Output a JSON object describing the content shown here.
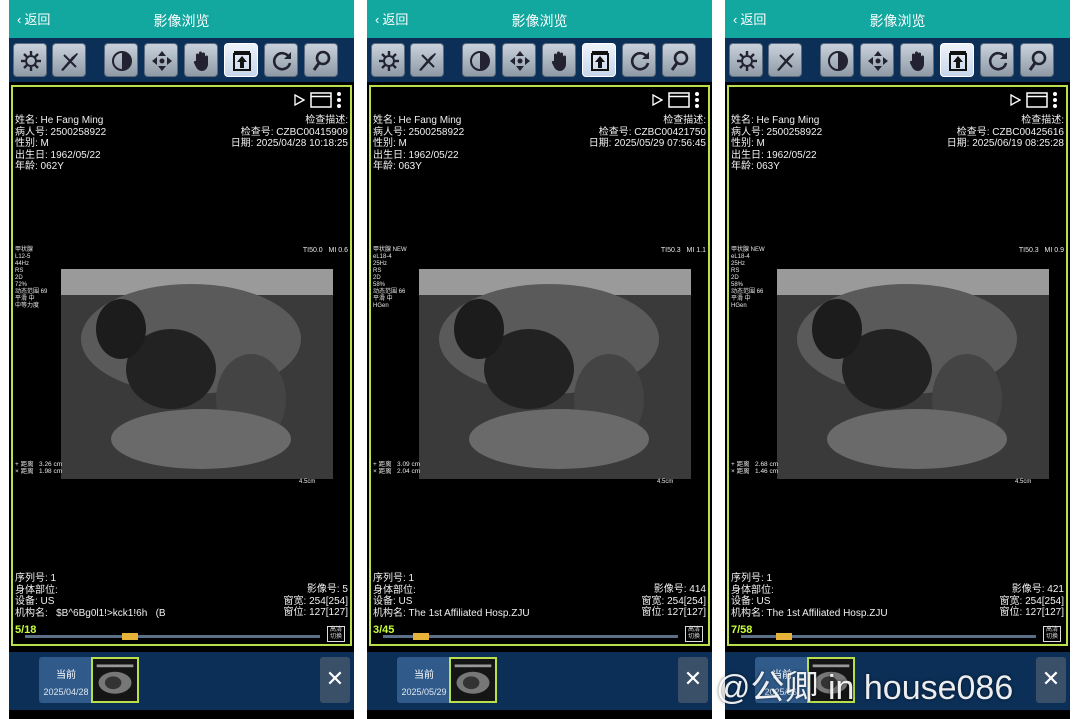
{
  "panels": [
    {
      "back": "返回",
      "title": "影像浏览",
      "patient": {
        "name": "姓名: He Fang Ming",
        "id": "病人号: 2500258922",
        "sex": "性别: M",
        "dob": "出生日: 1962/05/22",
        "age": "年龄: 062Y"
      },
      "exam": {
        "desc": "检查描述:",
        "no": "检查号: CZBC00415909",
        "date": "日期: 2025/04/28 10:18:25"
      },
      "us_left": "甲状腺\nL12-5\n44Hz\nRS\n2D\n72%\n动态范围 69\n平滑 中\n中等力度",
      "us_right": "TI50.0   MI 0.6",
      "measure": "+ 距离   3.26 cm\n× 距离   1.98 cm",
      "depth": "4.5cm",
      "series": {
        "seq": "序列号: 1",
        "part": "身体部位:",
        "device": "设备: US",
        "inst": "机构名:   $B^6Bg0l1!>kck1!6h   (B"
      },
      "image": {
        "no": "影像号: 5",
        "ww": "窗宽: 254[254]",
        "wl": "窗位: 127[127]"
      },
      "frame": "5/18",
      "progress": 0.33,
      "current": "当前",
      "date": "2025/04/28",
      "thumb_count": "18"
    },
    {
      "back": "返回",
      "title": "影像浏览",
      "patient": {
        "name": "姓名: He Fang Ming",
        "id": "病人号: 2500258922",
        "sex": "性别: M",
        "dob": "出生日: 1962/05/22",
        "age": "年龄: 063Y"
      },
      "exam": {
        "desc": "检查描述:",
        "no": "检查号: CZBC00421750",
        "date": "日期: 2025/05/29 07:56:45"
      },
      "us_left": "甲状腺 NEW\neL18-4\n25Hz\nRS\n2D\n58%\n动态范围 66\n平滑 中\nHGen",
      "us_right": "TI50.3   MI 1.1",
      "measure": "+ 距离   3.09 cm\n× 距离   2.04 cm",
      "depth": "4.5cm",
      "series": {
        "seq": "序列号: 1",
        "part": "身体部位:",
        "device": "设备: US",
        "inst": "机构名: The 1st Affiliated Hosp.ZJU"
      },
      "image": {
        "no": "影像号: 414",
        "ww": "窗宽: 254[254]",
        "wl": "窗位: 127[127]"
      },
      "frame": "3/45",
      "progress": 0.1,
      "current": "当前",
      "date": "2025/05/29",
      "thumb_count": ""
    },
    {
      "back": "返回",
      "title": "影像浏览",
      "patient": {
        "name": "姓名: He Fang Ming",
        "id": "病人号: 2500258922",
        "sex": "性别: M",
        "dob": "出生日: 1962/05/22",
        "age": "年龄: 063Y"
      },
      "exam": {
        "desc": "检查描述:",
        "no": "检查号: CZBC00425616",
        "date": "日期: 2025/06/19 08:25:28"
      },
      "us_left": "甲状腺 NEW\neL18-4\n25Hz\nRS\n2D\n58%\n动态范围 66\n平滑 中\nHGen",
      "us_right": "TI50.3   MI 0.9",
      "measure": "+ 距离   2.68 cm\n× 距离   1.46 cm",
      "depth": "4.5cm",
      "series": {
        "seq": "序列号: 1",
        "part": "身体部位:",
        "device": "设备: US",
        "inst": "机构名: The 1st Affiliated Hosp.ZJU"
      },
      "image": {
        "no": "影像号: 421",
        "ww": "窗宽: 254[254]",
        "wl": "窗位: 127[127]"
      },
      "frame": "7/58",
      "progress": 0.12,
      "current": "当前",
      "date": "2025/06/",
      "thumb_count": ""
    }
  ],
  "toolbar_icons": [
    "gear-icon",
    "scalpel-icon",
    "contrast-icon",
    "move-icon",
    "hand-icon",
    "export-icon",
    "rotate-icon",
    "magnify-icon"
  ],
  "stamp": "高清\n切换",
  "close": "✕",
  "watermark": "@公卿 in house086",
  "colors": {
    "header": "#12a79f",
    "toolbar": "#0b2f57",
    "viewer_border": "#b9e04a",
    "frame_text": "#c8ff3a"
  }
}
